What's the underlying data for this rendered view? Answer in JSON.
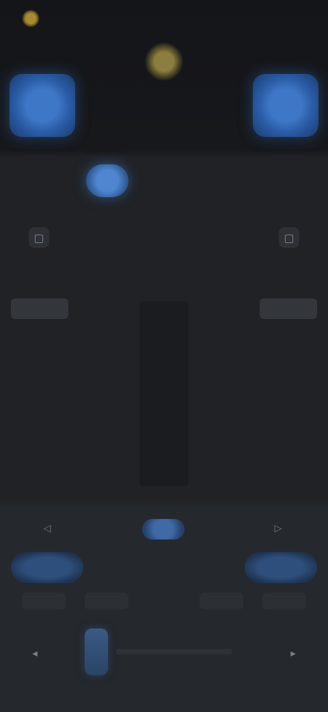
{
  "topbar": {
    "brand": "",
    "status": ""
  },
  "deck": {
    "left_label": "",
    "right_label": ""
  },
  "tabs": [
    {
      "label": ""
    },
    {
      "label": ""
    },
    {
      "label": ""
    }
  ],
  "middle": {
    "title": "",
    "subtitle": "",
    "left_button": "",
    "right_button": ""
  },
  "bottom": {
    "center_pill": "",
    "left_glow": "",
    "right_glow": "",
    "mid": "",
    "small_buttons": [
      "",
      "",
      "",
      "",
      ""
    ]
  },
  "icons": {
    "brand": "sun-icon",
    "side_left": "square-icon",
    "side_right": "square-icon",
    "bottom_left": "speaker-icon",
    "bottom_right": "speaker-icon"
  },
  "colors": {
    "accent": "#3f77c7",
    "background": "#202226"
  }
}
